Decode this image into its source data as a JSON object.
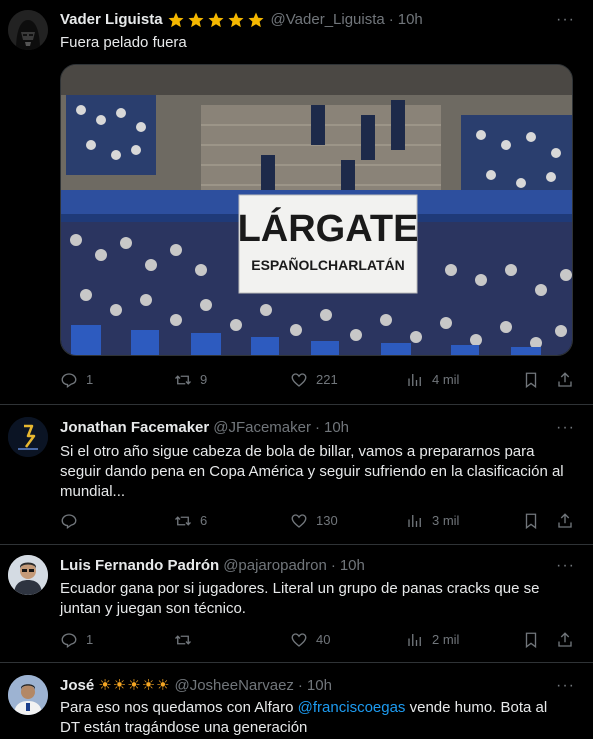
{
  "tweets": [
    {
      "name": "Vader Liguista",
      "handle": "@Vader_Liguista",
      "time": "10h",
      "text": "Fuera pelado fuera",
      "badge": "star-emoji",
      "replies": "1",
      "retweets": "9",
      "likes": "221",
      "views": "4 mil",
      "media": {
        "banner_line1": "LÁRGATE",
        "banner_line2": "ESPAÑOLCHARLATÁN"
      }
    },
    {
      "name": "Jonathan Facemaker",
      "handle": "@JFacemaker",
      "time": "10h",
      "text": "Si el otro año sigue cabeza de bola de billar, vamos a prepararnos para seguir dando pena en Copa América y seguir sufriendo en la clasificación al mundial...",
      "replies": "",
      "retweets": "6",
      "likes": "130",
      "views": "3 mil"
    },
    {
      "name": "Luis Fernando Padrón",
      "handle": "@pajaropadron",
      "time": "10h",
      "text": "Ecuador gana por si jugadores. Literal un grupo de panas cracks que se juntan y juegan son técnico.",
      "replies": "1",
      "retweets": "",
      "likes": "40",
      "views": "2 mil"
    },
    {
      "name": "José",
      "handle": "@JosheeNarvaez",
      "time": "10h",
      "badge": "sun-emoji",
      "text_before": "Para eso nos quedamos con Alfaro ",
      "mention": "@franciscoegas",
      "text_after": " vende humo. Bota al DT están tragándose una generación"
    }
  ],
  "colors": {
    "background": "#000000",
    "text": "#e7e9ea",
    "secondary": "#71767b",
    "link": "#1d9bf0",
    "divider": "#2f3336",
    "star": "#f5b800"
  }
}
